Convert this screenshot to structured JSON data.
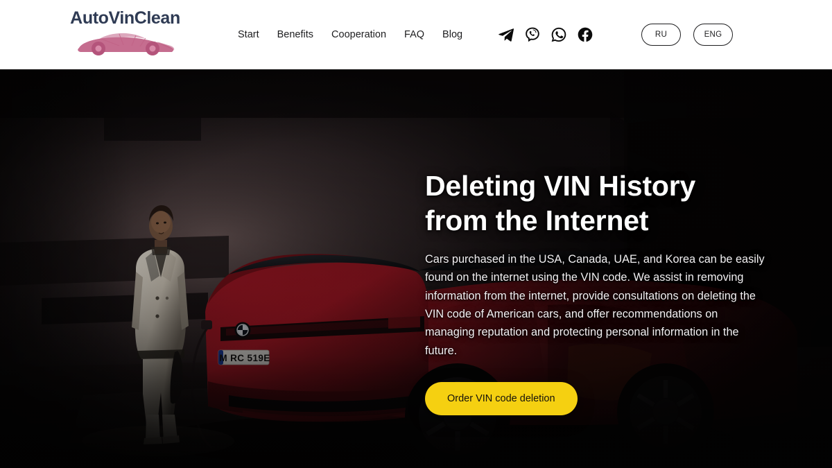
{
  "header": {
    "logo": {
      "text": "AutoVinClean",
      "icon": "sports-car-icon",
      "color": "#2f3b54",
      "car_color": "#c06186"
    },
    "nav": [
      {
        "label": "Start"
      },
      {
        "label": "Benefits"
      },
      {
        "label": "Cooperation"
      },
      {
        "label": "FAQ"
      },
      {
        "label": "Blog"
      }
    ],
    "socials": [
      {
        "name": "telegram-icon",
        "label": "Telegram"
      },
      {
        "name": "viber-icon",
        "label": "Viber"
      },
      {
        "name": "whatsapp-icon",
        "label": "WhatsApp"
      },
      {
        "name": "facebook-icon",
        "label": "Facebook"
      }
    ],
    "languages": [
      {
        "code": "RU",
        "active": false
      },
      {
        "code": "ENG",
        "active": false
      }
    ]
  },
  "hero": {
    "title": "Deleting VIN History\nfrom the Internet",
    "description": "Cars purchased in the USA, Canada, UAE, and Korea can be easily found on the internet using the VIN code. We assist in removing information from the internet, provide consultations on deleting the VIN code of American cars, and offer recommendations on managing reputation and protecting personal information in the future.",
    "cta_label": "Order VIN code deletion",
    "cta_color": "#f5d011",
    "image": {
      "description": "Woman in a cream coat standing in a dark garage beside a red BMW SUV",
      "license_plate": "M RC 519E",
      "car_badge": "BMW",
      "car_color": "#a8151f"
    }
  }
}
